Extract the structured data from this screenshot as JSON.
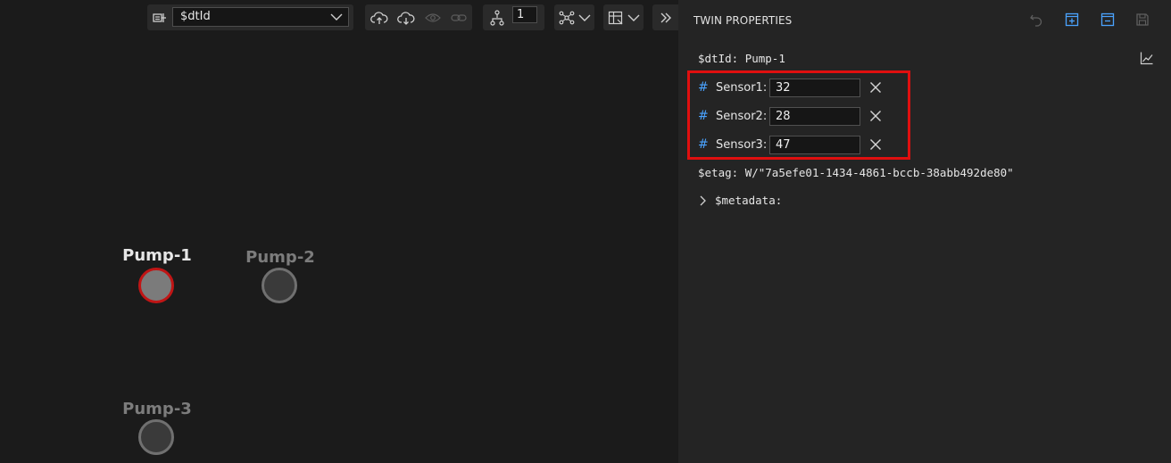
{
  "toolbar": {
    "id_select_value": "$dtId",
    "query_count_value": "1"
  },
  "graph": {
    "nodes": [
      {
        "label": "Pump-1",
        "selected": true
      },
      {
        "label": "Pump-2",
        "selected": false
      },
      {
        "label": "Pump-3",
        "selected": false
      }
    ]
  },
  "panel": {
    "title": "TWIN PROPERTIES",
    "dtid_key": "$dtId:",
    "dtid_value": "Pump-1",
    "properties": [
      {
        "icon": "#",
        "label": "Sensor1:",
        "value": "32"
      },
      {
        "icon": "#",
        "label": "Sensor2:",
        "value": "28"
      },
      {
        "icon": "#",
        "label": "Sensor3:",
        "value": "47"
      }
    ],
    "etag_key": "$etag:",
    "etag_value": "W/\"7a5efe01-1434-4861-bccb-38abb492de80\"",
    "metadata_label": "$metadata:"
  },
  "colors": {
    "accent": "#4aa3ff",
    "highlight": "#e00f0f",
    "selected_node_border": "#c01515"
  },
  "icons": [
    "id-toggle-icon",
    "chevron-down-icon",
    "upload-cloud-icon",
    "import-cloud-icon",
    "eye-icon",
    "link-icon",
    "query-branch-icon",
    "graph-layout-icon",
    "table-view-icon",
    "double-chevron-icon",
    "undo-icon",
    "expand-all-icon",
    "collapse-all-icon",
    "save-icon",
    "chart-icon",
    "close-icon",
    "chevron-right-icon"
  ]
}
